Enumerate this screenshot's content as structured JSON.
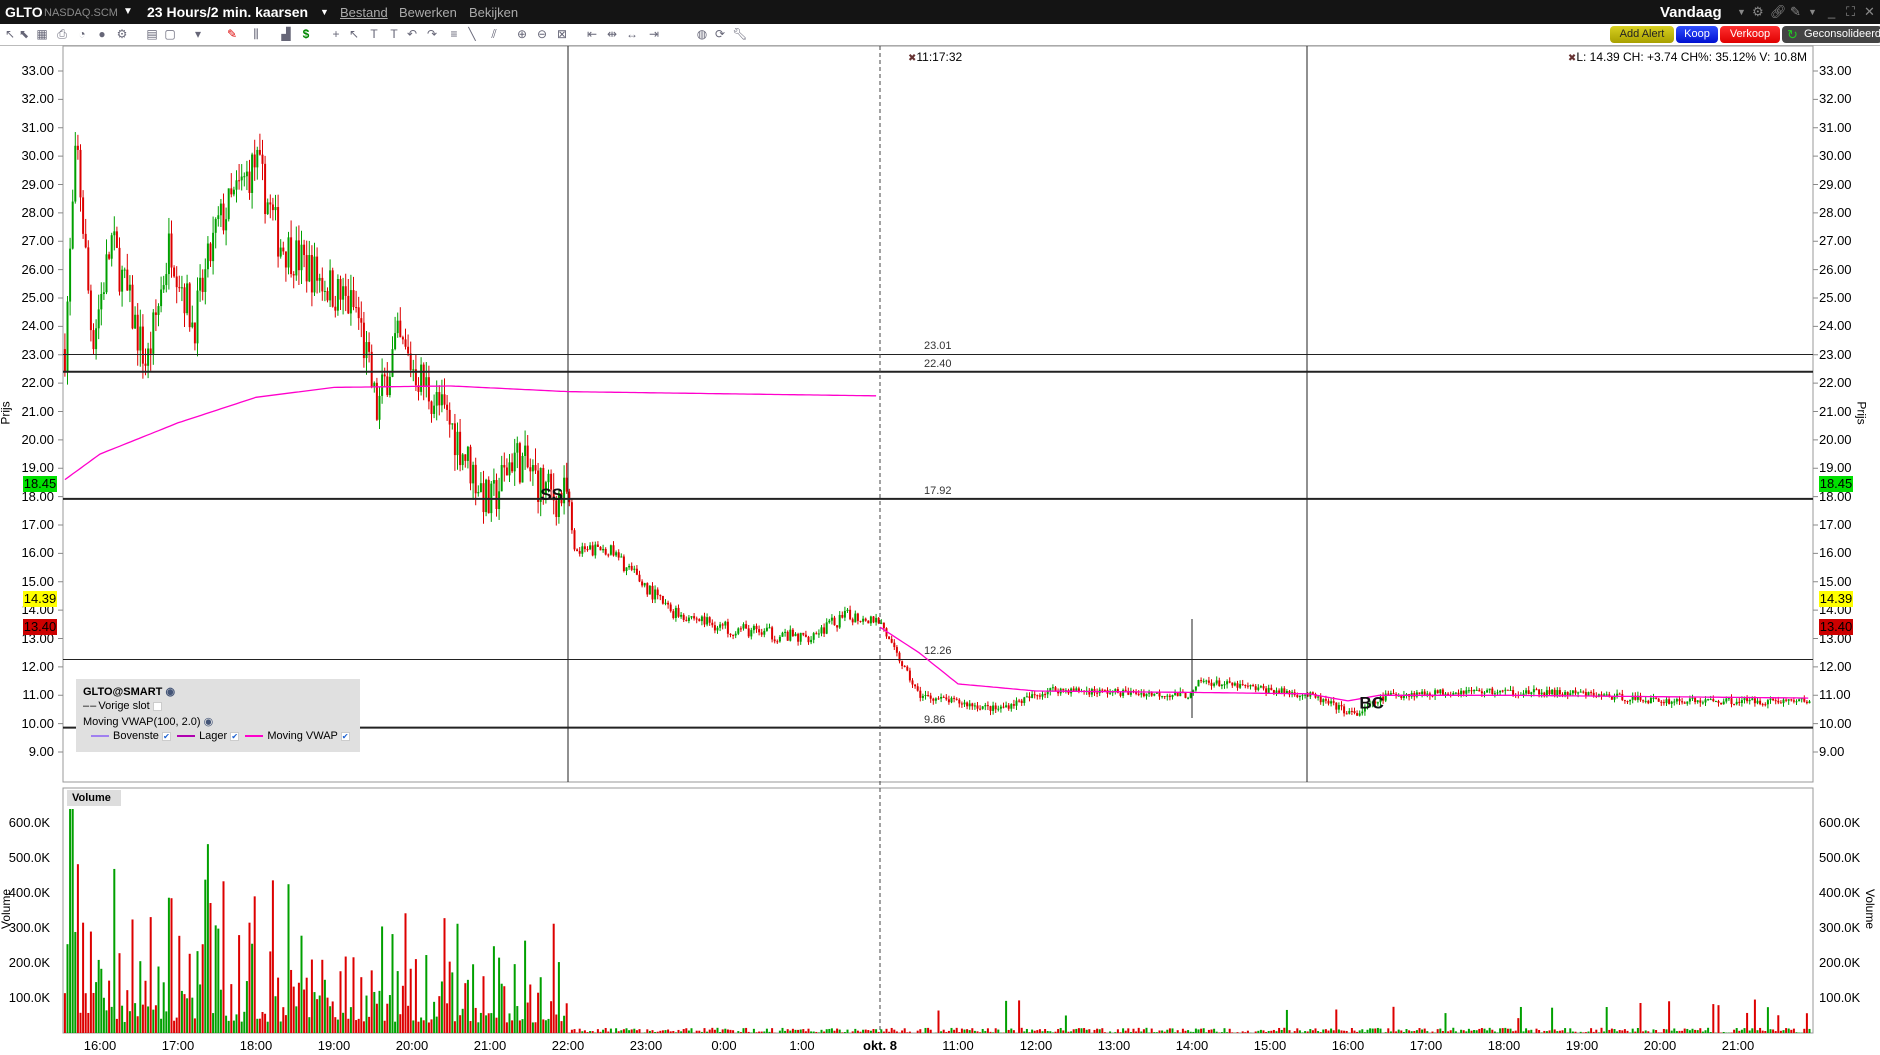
{
  "titlebar": {
    "symbol": "GLTO",
    "exchange": "NASDAQ.SCM",
    "period": "23 Hours/2 min. kaarsen",
    "menus": [
      "Bestand",
      "Bewerken",
      "Bekijken"
    ],
    "range": "Vandaag"
  },
  "toolbar": {
    "icons": [
      "cursor",
      "select",
      "grid",
      "print",
      "chart",
      "circle",
      "settings",
      "layout",
      "box",
      "dropdown",
      "pencil",
      "bars",
      "histogram",
      "dollar",
      "crosshair",
      "arrow",
      "text",
      "text-note",
      "undo",
      "redo",
      "fib",
      "line",
      "channel",
      "zoom-in",
      "zoom-out",
      "zoom-fit",
      "shift-left",
      "shift-mid",
      "shift-both",
      "shift-right",
      "globe",
      "refresh",
      "wrench"
    ],
    "add_alert": "Add Alert",
    "buy": "Koop",
    "sell": "Verkoop",
    "consolidated": "Geconsolideerd"
  },
  "info": {
    "crosshair_time": "11:17:32",
    "quote": "L: 14.39 CH: +3.74 CH%: 35.12% V: 10.8M"
  },
  "price_axis": {
    "title": "Prijs",
    "labels": [
      "33.00",
      "32.00",
      "31.00",
      "30.00",
      "29.00",
      "28.00",
      "27.00",
      "26.00",
      "25.00",
      "24.00",
      "23.00",
      "22.00",
      "21.00",
      "20.00",
      "19.00",
      "18.00",
      "17.00",
      "16.00",
      "15.00",
      "14.00",
      "13.00",
      "12.00",
      "11.00",
      "10.00",
      "9.00"
    ],
    "tags": [
      {
        "value": "18.45",
        "color": "#00e000"
      },
      {
        "value": "14.39",
        "color": "#ffff00"
      },
      {
        "value": "13.40",
        "color": "#cc0000"
      }
    ]
  },
  "levels": [
    {
      "price": 23.01,
      "label": "23.01"
    },
    {
      "price": 22.4,
      "label": "22.40"
    },
    {
      "price": 17.92,
      "label": "17.92"
    },
    {
      "price": 12.26,
      "label": "12.26"
    },
    {
      "price": 9.86,
      "label": "9.86"
    }
  ],
  "annotations": [
    {
      "text": "SS",
      "t": 5.8,
      "price": 18.1
    },
    {
      "text": "BC",
      "t": 16.3,
      "price": 10.75
    }
  ],
  "legend": {
    "contract": "GLTO@SMART",
    "prev_close": "Vorige slot",
    "indicator": "Moving VWAP(100, 2.0)",
    "series": [
      {
        "name": "Bovenste",
        "color": "#a080f0"
      },
      {
        "name": "Lager",
        "color": "#b000b0"
      },
      {
        "name": "Moving VWAP",
        "color": "#ff00cc"
      }
    ]
  },
  "volume_axis": {
    "title": "Volume",
    "panel_label": "Volume",
    "labels": [
      "600.0K",
      "500.0K",
      "400.0K",
      "300.0K",
      "200.0K",
      "100.0K"
    ]
  },
  "time_axis": [
    {
      "label": "16:00",
      "t": 0
    },
    {
      "label": "17:00",
      "t": 1
    },
    {
      "label": "18:00",
      "t": 2
    },
    {
      "label": "19:00",
      "t": 3
    },
    {
      "label": "20:00",
      "t": 4
    },
    {
      "label": "21:00",
      "t": 5
    },
    {
      "label": "22:00",
      "t": 6
    },
    {
      "label": "23:00",
      "t": 7
    },
    {
      "label": "0:00",
      "t": 8
    },
    {
      "label": "1:00",
      "t": 9
    },
    {
      "label": "okt. 8",
      "t": 10
    },
    {
      "label": "11:00",
      "t": 11
    },
    {
      "label": "12:00",
      "t": 12
    },
    {
      "label": "13:00",
      "t": 13
    },
    {
      "label": "14:00",
      "t": 14
    },
    {
      "label": "15:00",
      "t": 15
    },
    {
      "label": "16:00",
      "t": 16
    },
    {
      "label": "17:00",
      "t": 17
    },
    {
      "label": "18:00",
      "t": 18
    },
    {
      "label": "19:00",
      "t": 19
    },
    {
      "label": "20:00",
      "t": 20
    },
    {
      "label": "21:00",
      "t": 21
    }
  ],
  "chart_data": {
    "type": "candlestick",
    "price_path": [
      [
        -0.45,
        23.2
      ],
      [
        -0.3,
        30.5
      ],
      [
        -0.1,
        23.5
      ],
      [
        0.15,
        27
      ],
      [
        0.6,
        22.6
      ],
      [
        0.9,
        27
      ],
      [
        1.2,
        24
      ],
      [
        1.5,
        27.5
      ],
      [
        2.0,
        29.8
      ],
      [
        2.3,
        27
      ],
      [
        2.9,
        25.5
      ],
      [
        3.3,
        24.5
      ],
      [
        3.55,
        21
      ],
      [
        3.8,
        23.5
      ],
      [
        4.5,
        20.5
      ],
      [
        5.0,
        17.6
      ],
      [
        5.3,
        19.5
      ],
      [
        5.8,
        18
      ],
      [
        6.0,
        18
      ],
      [
        6.1,
        16
      ],
      [
        6.5,
        16.2
      ],
      [
        7.3,
        14
      ],
      [
        8.0,
        13.4
      ],
      [
        9.0,
        13
      ],
      [
        9.6,
        13.8
      ],
      [
        10.0,
        13.7
      ],
      [
        10.1,
        13
      ],
      [
        10.5,
        11
      ],
      [
        11.5,
        10.5
      ],
      [
        12.2,
        11.2
      ],
      [
        14.0,
        11.0
      ],
      [
        14.1,
        11.5
      ],
      [
        15.5,
        11
      ],
      [
        16.1,
        10.3
      ],
      [
        16.5,
        11
      ],
      [
        17.5,
        11.15
      ],
      [
        19.0,
        11.05
      ],
      [
        20.0,
        10.8
      ],
      [
        21.95,
        10.8
      ]
    ],
    "vwap_day1": [
      [
        -0.45,
        18.6
      ],
      [
        0,
        19.5
      ],
      [
        1,
        20.6
      ],
      [
        2,
        21.5
      ],
      [
        3,
        21.85
      ],
      [
        4.5,
        21.9
      ],
      [
        6,
        21.7
      ],
      [
        10,
        21.55
      ]
    ],
    "vwap_day2": [
      [
        10,
        13.4
      ],
      [
        10.5,
        12.5
      ],
      [
        11,
        11.4
      ],
      [
        12,
        11.15
      ],
      [
        14,
        11.1
      ],
      [
        15.5,
        11.05
      ],
      [
        16,
        10.8
      ],
      [
        16.4,
        11.0
      ],
      [
        18,
        11.0
      ],
      [
        21.95,
        10.9
      ]
    ],
    "volume_max_k": 650
  }
}
